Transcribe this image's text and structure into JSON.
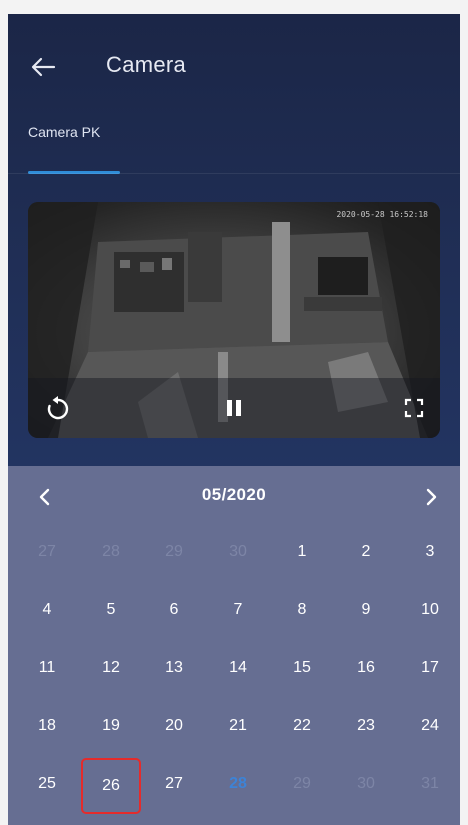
{
  "header": {
    "title": "Camera",
    "back_icon": "arrow-left-icon"
  },
  "tabs": [
    {
      "label": "Camera PK",
      "active": true
    }
  ],
  "video": {
    "timestamp": "2020-05-28 16:52:18",
    "controls": {
      "replay_icon": "replay-icon",
      "pause_icon": "pause-icon",
      "fullscreen_icon": "fullscreen-icon"
    }
  },
  "calendar": {
    "month_label": "05/2020",
    "prev_icon": "chevron-left-icon",
    "next_icon": "chevron-right-icon",
    "weeks": [
      [
        "27",
        "28",
        "29",
        "30",
        "1",
        "2",
        "3"
      ],
      [
        "4",
        "5",
        "6",
        "7",
        "8",
        "9",
        "10"
      ],
      [
        "11",
        "12",
        "13",
        "14",
        "15",
        "16",
        "17"
      ],
      [
        "18",
        "19",
        "20",
        "21",
        "22",
        "23",
        "24"
      ],
      [
        "25",
        "26",
        "27",
        "28",
        "29",
        "30",
        "31"
      ]
    ],
    "selected_day": "26",
    "today_day": "28"
  },
  "colors": {
    "accent": "#2f8dd8",
    "selection_border": "#e52b2b",
    "calendar_bg": "#666e92",
    "app_bg": "#1f2d53"
  }
}
